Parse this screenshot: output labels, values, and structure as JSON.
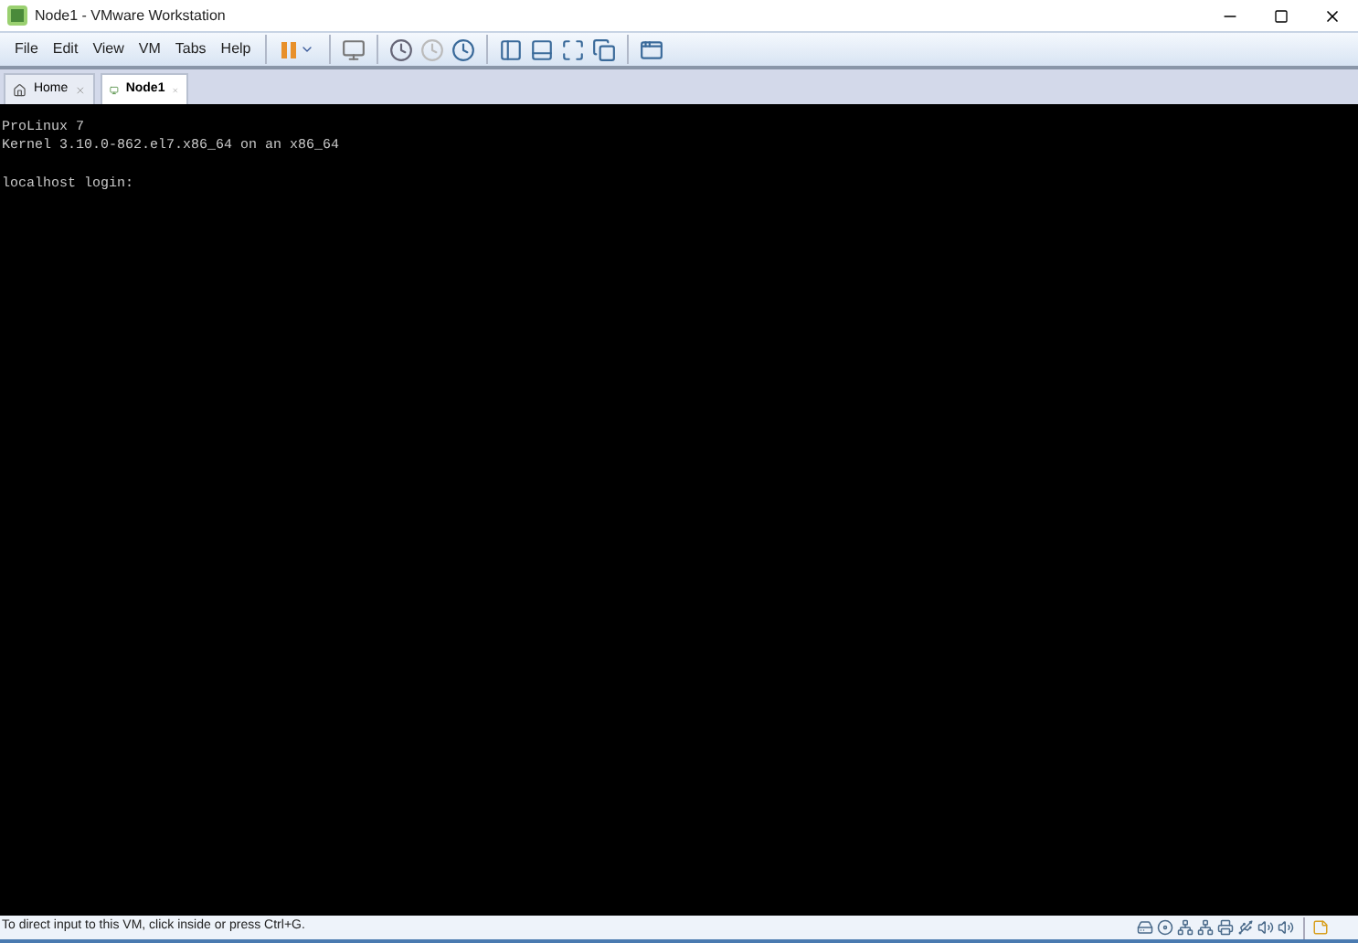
{
  "window": {
    "title": "Node1 - VMware Workstation"
  },
  "menu": [
    "File",
    "Edit",
    "View",
    "VM",
    "Tabs",
    "Help"
  ],
  "tabs": [
    {
      "label": "Home",
      "selected": false
    },
    {
      "label": "Node1",
      "selected": true
    }
  ],
  "console": {
    "blocks": [
      [
        "ProLinux 7",
        "Kernel 3.10.0-862.el7.x86_64 on an x86_64"
      ],
      [
        "localhost login:"
      ]
    ]
  },
  "status_bar": {
    "message": "To direct input to this VM, click inside or press Ctrl+G."
  }
}
